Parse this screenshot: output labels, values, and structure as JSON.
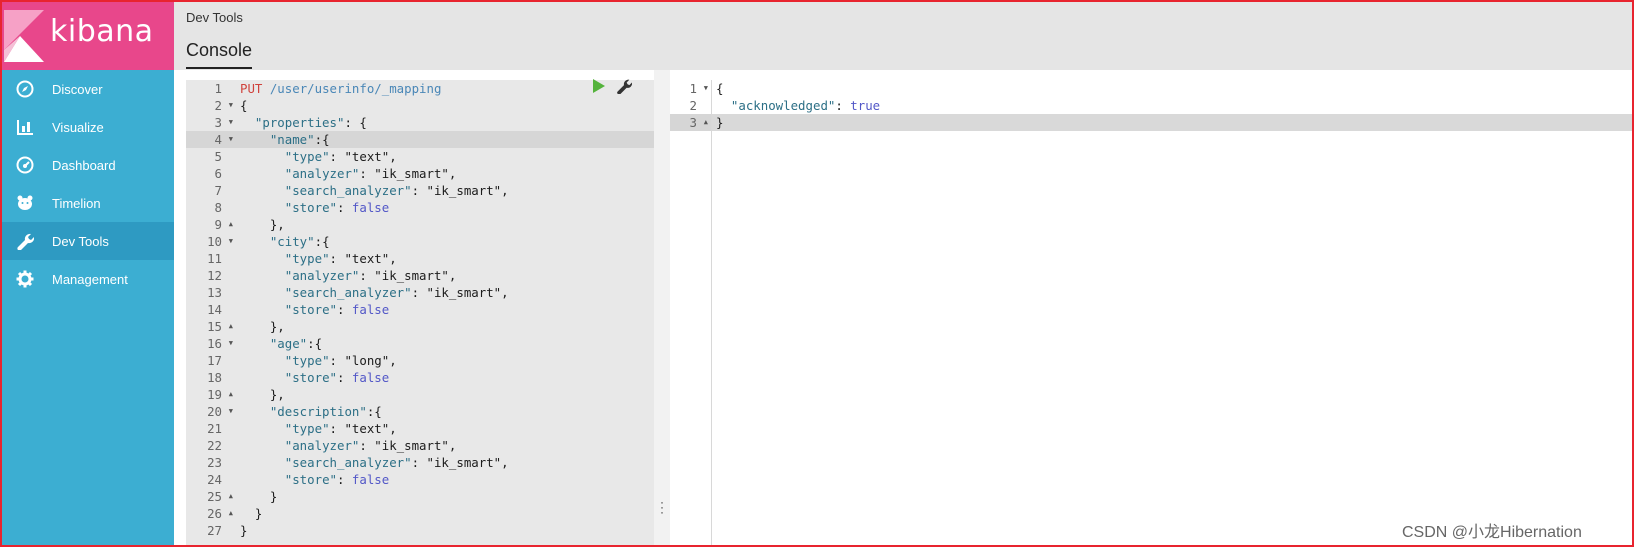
{
  "brand": {
    "name": "kibana",
    "color": "#e8478b",
    "sidebar_color": "#3caed2"
  },
  "sidebar": {
    "items": [
      {
        "label": "Discover",
        "icon": "compass-icon"
      },
      {
        "label": "Visualize",
        "icon": "bar-chart-icon"
      },
      {
        "label": "Dashboard",
        "icon": "gauge-icon"
      },
      {
        "label": "Timelion",
        "icon": "bear-icon"
      },
      {
        "label": "Dev Tools",
        "icon": "wrench-icon",
        "active": true
      },
      {
        "label": "Management",
        "icon": "gear-icon"
      }
    ]
  },
  "header": {
    "breadcrumb": "Dev Tools",
    "tab": "Console"
  },
  "request": {
    "method": "PUT",
    "path": "/user/userinfo/_mapping",
    "lines": [
      "{",
      "  \"properties\": {",
      "    \"name\":{",
      "      \"type\": \"text\",",
      "      \"analyzer\": \"ik_smart\",",
      "      \"search_analyzer\": \"ik_smart\",",
      "      \"store\": false",
      "    },",
      "    \"city\":{",
      "      \"type\": \"text\",",
      "      \"analyzer\": \"ik_smart\",",
      "      \"search_analyzer\": \"ik_smart\",",
      "      \"store\": false",
      "    },",
      "    \"age\":{",
      "      \"type\": \"long\",",
      "      \"store\": false",
      "    },",
      "    \"description\":{",
      "      \"type\": \"text\",",
      "      \"analyzer\": \"ik_smart\",",
      "      \"search_analyzer\": \"ik_smart\",",
      "      \"store\": false",
      "    }",
      "  }",
      "}"
    ],
    "fold_open": [
      2,
      3,
      4,
      10,
      16,
      20
    ],
    "fold_close": [
      9,
      15,
      19,
      25,
      26
    ],
    "highlight_line": 4
  },
  "response": {
    "lines": [
      "{",
      "  \"acknowledged\": true",
      "}"
    ],
    "fold_open": [
      1
    ],
    "fold_close": [
      3
    ],
    "highlight_line": 3
  },
  "watermark": "CSDN @小龙Hibernation"
}
